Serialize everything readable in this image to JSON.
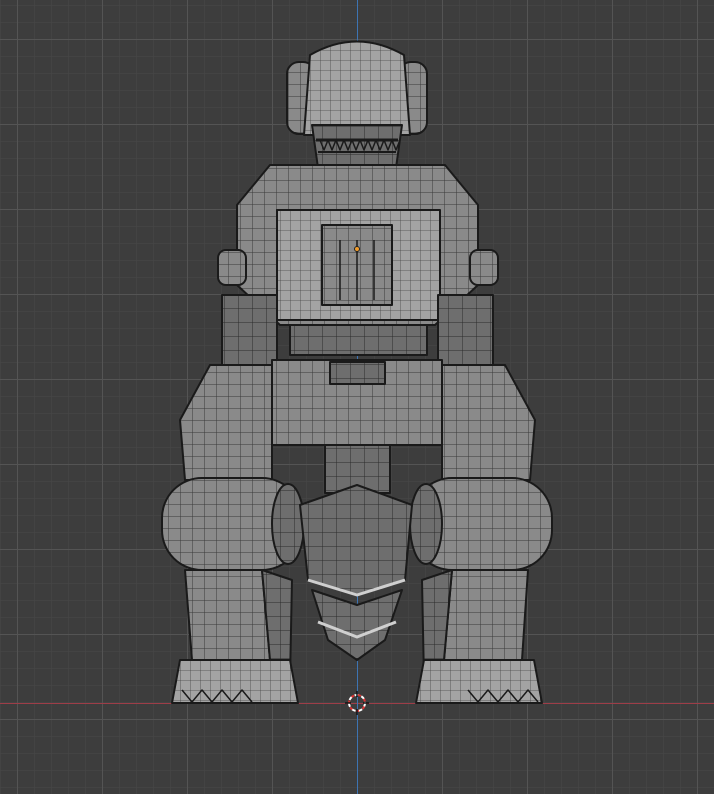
{
  "viewport": {
    "grid_color": "#555555",
    "background_color": "#3d3d3d",
    "axis_x_color": "#9e3d48",
    "axis_z_color": "#3d74b3",
    "origin_color": "#f29c2b",
    "model_color": "#8d8d8d",
    "edge_color": "#1a1a1a"
  }
}
